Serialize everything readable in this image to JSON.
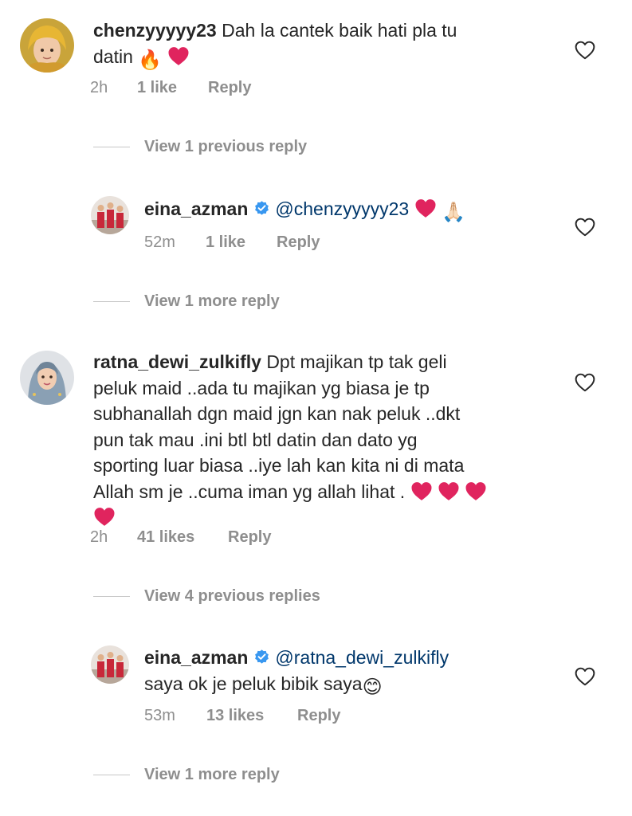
{
  "comments": [
    {
      "username": "chenzyyyyy23",
      "text_line1": "Dah la cantek baik hati pla tu",
      "text_line2": "datin",
      "emoji_line2": "🔥",
      "time": "2h",
      "likes": "1 like",
      "reply": "Reply"
    },
    {
      "username": "eina_azman",
      "mention": "@chenzyyyyy23",
      "emoji_after": "🙏🏻",
      "time": "52m",
      "likes": "1 like",
      "reply": "Reply"
    },
    {
      "username": "ratna_dewi_zulkifly",
      "text_line1": "Dpt majikan tp tak geli",
      "lines": [
        "peluk maid ..ada tu majikan yg biasa je tp",
        "subhanallah dgn maid jgn kan nak peluk ..dkt",
        "pun tak mau .ini btl btl datin dan dato yg",
        "sporting luar biasa ..iye lah kan kita ni di mata",
        "Allah sm je ..cuma iman yg allah lihat ."
      ],
      "time": "2h",
      "likes": "41 likes",
      "reply": "Reply"
    },
    {
      "username": "eina_azman",
      "mention": "@ratna_dewi_zulkifly",
      "text_line2": "saya ok je peluk bibik saya",
      "emoji_line2": "😊",
      "time": "53m",
      "likes": "13 likes",
      "reply": "Reply"
    }
  ],
  "view_replies": [
    "View 1 previous reply",
    "View 1 more reply",
    "View 4 previous replies",
    "View 1 more reply"
  ],
  "colors": {
    "username": "#262626",
    "mention": "#00376b",
    "meta": "#8e8e8e",
    "heart_emoji": "#e0245e",
    "verified": "#3897f0"
  }
}
